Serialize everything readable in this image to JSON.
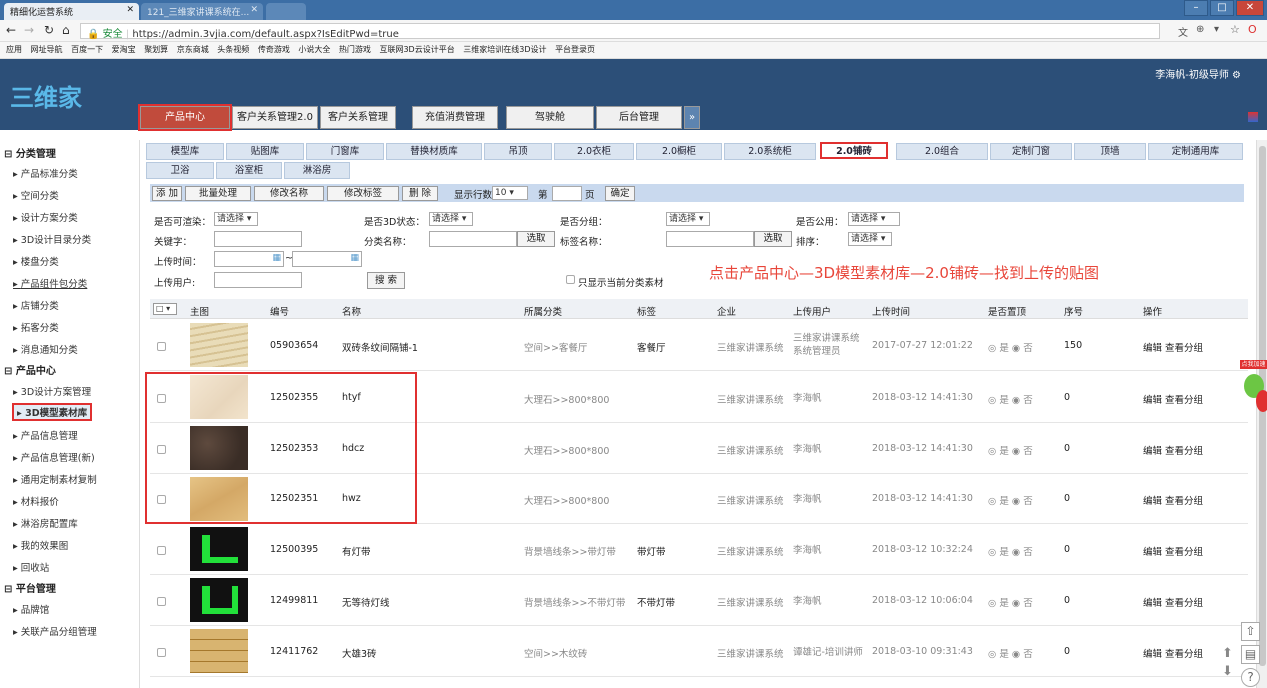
{
  "browser": {
    "tabs": [
      {
        "label": "精细化运营系统"
      },
      {
        "label": "121_三维家讲课系统在..."
      },
      {
        "label": ""
      }
    ],
    "url_secure": "安全",
    "url": "https://admin.3vjia.com/default.aspx?IsEditPwd=true",
    "bookmarks": [
      "应用",
      "网址导航",
      "百度一下",
      "爱淘宝",
      "聚划算",
      "京东商城",
      "头条视频",
      "传奇游戏",
      "小说大全",
      "热门游戏",
      "互联网3D云设计平台",
      "三维家培训在线3D设计",
      "平台登录页"
    ]
  },
  "header": {
    "logo": "三维家",
    "user": "李海帆-初级导师",
    "nav_tabs": [
      "产品中心",
      "客户关系管理2.0",
      "客户关系管理",
      "充值消费管理",
      "驾驶舱",
      "后台管理"
    ],
    "nav_more": "»"
  },
  "sidebar": {
    "sections": [
      {
        "title": "分类管理",
        "items": [
          "产品标准分类",
          "空间分类",
          "设计方案分类",
          "3D设计目录分类",
          "楼盘分类",
          "产品组件包分类",
          "店铺分类",
          "拓客分类",
          "消息通知分类"
        ]
      },
      {
        "title": "产品中心",
        "items": [
          "3D设计方案管理",
          "3D模型素材库",
          "产品信息管理",
          "产品信息管理(新)",
          "通用定制素材复制",
          "材料报价",
          "淋浴房配置库",
          "我的效果图",
          "回收站"
        ]
      },
      {
        "title": "平台管理",
        "items": [
          "品牌馆",
          "关联产品分组管理"
        ]
      }
    ]
  },
  "subtabs": {
    "row1": [
      "模型库",
      "贴图库",
      "门窗库",
      "替换材质库",
      "吊顶",
      "2.0衣柜",
      "2.0橱柜",
      "2.0系统柜",
      "2.0铺砖",
      "2.0组合",
      "定制门窗",
      "顶墙",
      "定制通用库"
    ],
    "row2": [
      "卫浴",
      "浴室柜",
      "淋浴房"
    ]
  },
  "toolbar": {
    "add": "添 加",
    "batch": "批量处理",
    "rename": "修改名称",
    "retag": "修改标签",
    "delete": "删 除",
    "rows_label": "显示行数",
    "rows_value": "10",
    "page_prefix": "第",
    "page_suffix": "页",
    "confirm": "确定"
  },
  "filters": {
    "renderable_label": "是否可渲染：",
    "renderable_value": "请选择",
    "status3d_label": "是否3D状态：",
    "status3d_value": "请选择",
    "grouped_label": "是否分组：",
    "grouped_value": "请选择",
    "public_label": "是否公用：",
    "public_value": "请选择",
    "keyword_label": "关键字：",
    "category_label": "分类名称：",
    "select_btn": "选取",
    "tag_label": "标签名称：",
    "sort_label": "排序：",
    "sort_value": "请选择",
    "upload_time_label": "上传时间：",
    "range_sep": "~",
    "uploader_label": "上传用户:",
    "search_btn": "搜 索",
    "only_current": "只显示当前分类素材"
  },
  "annotation": "点击产品中心—3D模型素材库—2.0铺砖—找到上传的贴图",
  "table": {
    "headers": [
      "主图",
      "编号",
      "名称",
      "所属分类",
      "标签",
      "企业",
      "上传用户",
      "上传时间",
      "是否置顶",
      "序号",
      "操作"
    ],
    "rows": [
      {
        "code": "05903654",
        "name": "双砖条纹间隔铺-1",
        "category": "空间>>客餐厅",
        "tag": "客餐厅",
        "company": "三维家讲课系统",
        "uploader": "三维家讲课系统\n系统管理员",
        "time": "2017-07-27 12:01:22",
        "top_yes": "是",
        "top_no": "否",
        "seq": "150",
        "ops": "编辑 查看分组",
        "thumb": "wave"
      },
      {
        "code": "12502355",
        "name": "htyf",
        "category": "大理石>>800*800",
        "tag": "",
        "company": "三维家讲课系统",
        "uploader": "李海帆",
        "time": "2018-03-12 14:41:30",
        "top_yes": "是",
        "top_no": "否",
        "seq": "0",
        "ops": "编辑 查看分组",
        "thumb": "cream"
      },
      {
        "code": "12502353",
        "name": "hdcz",
        "category": "大理石>>800*800",
        "tag": "",
        "company": "三维家讲课系统",
        "uploader": "李海帆",
        "time": "2018-03-12 14:41:30",
        "top_yes": "是",
        "top_no": "否",
        "seq": "0",
        "ops": "编辑 查看分组",
        "thumb": "brown"
      },
      {
        "code": "12502351",
        "name": "hwz",
        "category": "大理石>>800*800",
        "tag": "",
        "company": "三维家讲课系统",
        "uploader": "李海帆",
        "time": "2018-03-12 14:41:30",
        "top_yes": "是",
        "top_no": "否",
        "seq": "0",
        "ops": "编辑 查看分组",
        "thumb": "beige"
      },
      {
        "code": "12500395",
        "name": "有灯带",
        "category": "背景墙线条>>带灯带",
        "tag": "带灯带",
        "company": "三维家讲课系统",
        "uploader": "李海帆",
        "time": "2018-03-12 10:32:24",
        "top_yes": "是",
        "top_no": "否",
        "seq": "0",
        "ops": "编辑 查看分组",
        "thumb": "green1"
      },
      {
        "code": "12499811",
        "name": "无等待灯线",
        "category": "背景墙线条>>不带灯带",
        "tag": "不带灯带",
        "company": "三维家讲课系统",
        "uploader": "李海帆",
        "time": "2018-03-12 10:06:04",
        "top_yes": "是",
        "top_no": "否",
        "seq": "0",
        "ops": "编辑 查看分组",
        "thumb": "green2"
      },
      {
        "code": "12411762",
        "name": "大雄3砖",
        "category": "空间>>木纹砖",
        "tag": "",
        "company": "三维家讲课系统",
        "uploader": "谭雄记-培训讲师",
        "time": "2018-03-10 09:31:43",
        "top_yes": "是",
        "top_no": "否",
        "seq": "0",
        "ops": "编辑 查看分组",
        "thumb": "brick"
      }
    ]
  },
  "colors": {
    "accent_red": "#e03030",
    "header_bg": "#2c4f78",
    "annotation": "#e8463a"
  }
}
